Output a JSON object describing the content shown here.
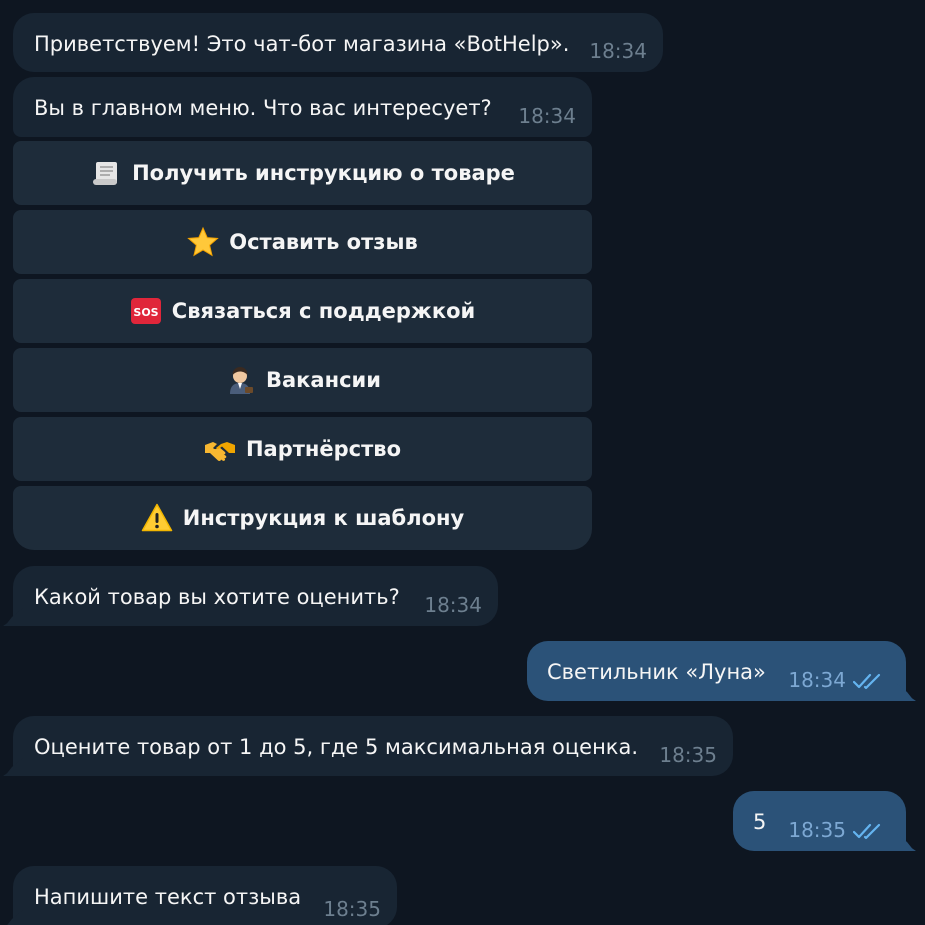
{
  "messages": [
    {
      "text": "Приветствуем! Это чат-бот магазина «BotHelp».",
      "time": "18:34"
    },
    {
      "text": "Вы в главном меню. Что вас интересует?",
      "time": "18:34"
    },
    {
      "text": "Какой товар вы хотите оценить?",
      "time": "18:34"
    },
    {
      "text": "Светильник «Луна»",
      "time": "18:34"
    },
    {
      "text": "Оцените товар от 1 до 5, где 5 максимальная оценка.",
      "time": "18:35"
    },
    {
      "text": "5",
      "time": "18:35"
    },
    {
      "text": "Напишите текст отзыва",
      "time": "18:35"
    }
  ],
  "keyboard": {
    "buttons": [
      {
        "label": "Получить инструкцию о товаре",
        "icon": "scroll-icon"
      },
      {
        "label": "Оставить отзыв",
        "icon": "star-icon"
      },
      {
        "label": "Связаться с поддержкой",
        "icon": "sos-icon"
      },
      {
        "label": "Вакансии",
        "icon": "office-worker-icon"
      },
      {
        "label": "Партнёрство",
        "icon": "handshake-icon"
      },
      {
        "label": "Инструкция к шаблону",
        "icon": "warning-icon"
      }
    ]
  },
  "colors": {
    "background": "#0e1621",
    "incoming_bubble": "#182533",
    "outgoing_bubble": "#2b5278",
    "keyboard_button": "#1e2c3a",
    "read_checks": "#64b4f0"
  }
}
